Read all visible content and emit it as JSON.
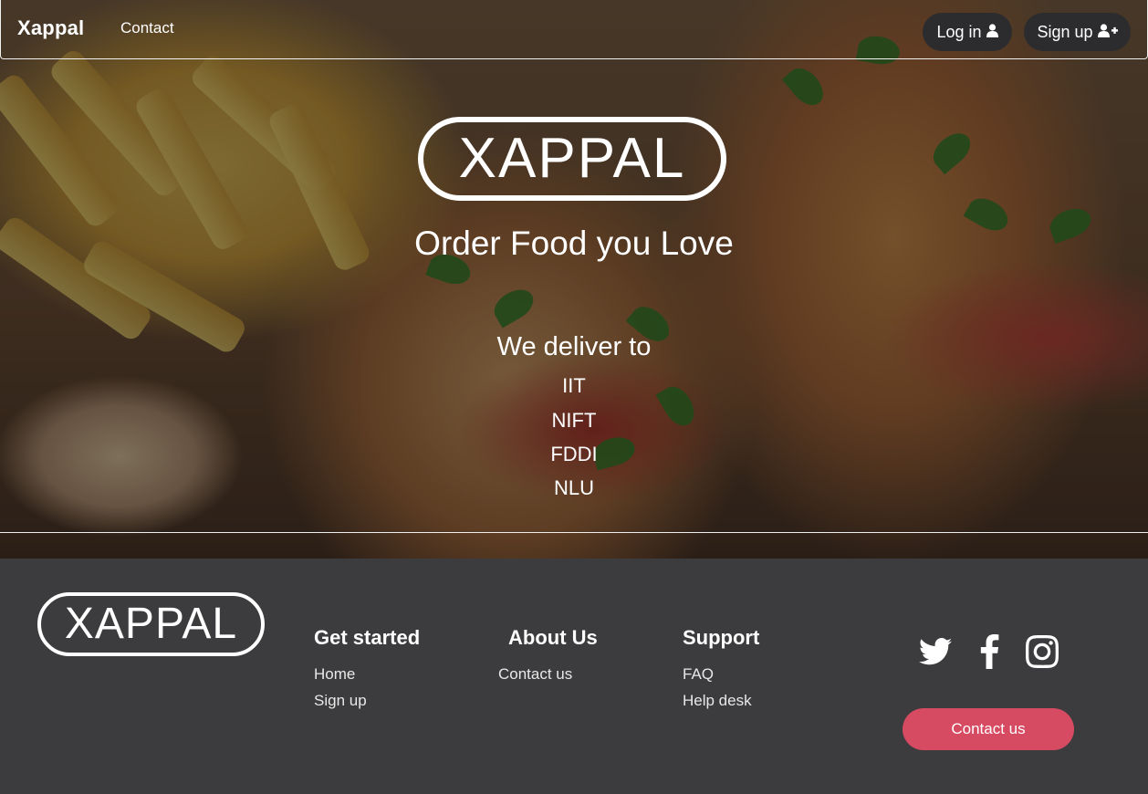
{
  "navbar": {
    "brand": "Xappal",
    "links": [
      {
        "label": "Contact"
      }
    ],
    "login_label": "Log in",
    "signup_label": "Sign up"
  },
  "hero": {
    "logo_text": "XAPPAL",
    "tagline": "Order Food you Love",
    "deliver_heading": "We deliver to",
    "locations": [
      "IIT",
      "NIFT",
      "FDDI",
      "NLU"
    ]
  },
  "footer": {
    "logo_text": "XAPPAL",
    "columns": [
      {
        "title": "Get started",
        "links": [
          "Home",
          "Sign up"
        ]
      },
      {
        "title": "About Us",
        "links": [
          "Contact us"
        ]
      },
      {
        "title": "Support",
        "links": [
          "FAQ",
          "Help desk"
        ]
      }
    ],
    "social_icons": [
      "twitter-icon",
      "facebook-icon",
      "instagram-icon"
    ],
    "contact_button_label": "Contact us"
  },
  "colors": {
    "footer_bg": "#3c3c3e",
    "button_pill_bg": "#2c2c2e",
    "contact_button_bg": "#d64a62"
  }
}
